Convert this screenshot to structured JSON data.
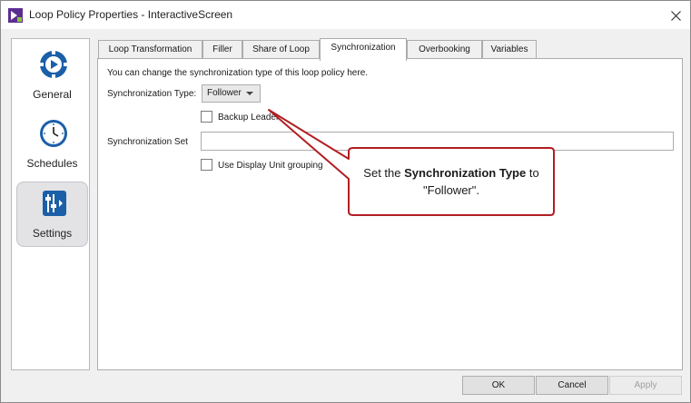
{
  "window": {
    "title": "Loop Policy Properties - InteractiveScreen"
  },
  "sidebar": {
    "items": [
      {
        "label": "General",
        "icon": "play-circle-icon"
      },
      {
        "label": "Schedules",
        "icon": "clock-icon"
      },
      {
        "label": "Settings",
        "icon": "settings-sliders-icon"
      }
    ]
  },
  "tabs": [
    {
      "label": "Loop Transformation"
    },
    {
      "label": "Filler"
    },
    {
      "label": "Share of Loop"
    },
    {
      "label": "Synchronization"
    },
    {
      "label": "Overbooking"
    },
    {
      "label": "Variables"
    }
  ],
  "sync": {
    "description": "You can change the synchronization type of this loop policy here.",
    "type_label": "Synchronization Type:",
    "type_value": "Follower",
    "backup_leader_label": "Backup Leader",
    "set_label": "Synchronization Set",
    "set_value": "",
    "display_unit_label": "Use Display Unit grouping"
  },
  "buttons": {
    "ok": "OK",
    "cancel": "Cancel",
    "apply": "Apply"
  },
  "callout": {
    "prefix": "Set the",
    "bold": "Synchronization Type",
    "suffix": "to",
    "line2": "\"Follower\"."
  },
  "colors": {
    "callout_border": "#b01e23",
    "accent_blue": "#1b5fa8",
    "app_icon": "#5b2d90"
  }
}
